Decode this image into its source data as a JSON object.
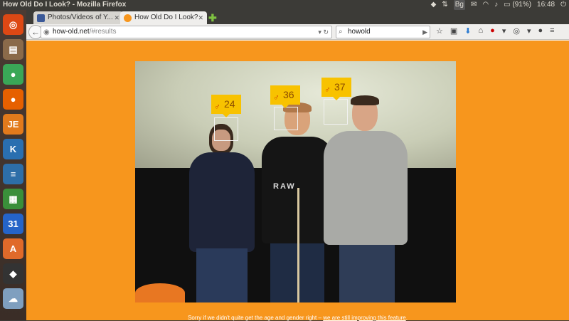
{
  "system": {
    "window_title": "How Old Do I Look? - Mozilla Firefox",
    "battery": "(91%)",
    "clock": "16:48",
    "keyboard": "Bg"
  },
  "launcher": {
    "items": [
      {
        "name": "ubuntu-logo-icon",
        "glyph": "◎",
        "color": "#dd4814"
      },
      {
        "name": "files-icon",
        "glyph": "▤",
        "color": "#8a6a4a"
      },
      {
        "name": "chromium-icon",
        "glyph": "●",
        "color": "#3aa757"
      },
      {
        "name": "firefox-icon",
        "glyph": "●",
        "color": "#e66000"
      },
      {
        "name": "jetbrains-icon",
        "glyph": "JE",
        "color": "#e27a1c"
      },
      {
        "name": "kde-connect-icon",
        "glyph": "K",
        "color": "#2a6fb0"
      },
      {
        "name": "writer-icon",
        "glyph": "≡",
        "color": "#2d6ea8"
      },
      {
        "name": "calc-icon",
        "glyph": "▦",
        "color": "#3a8f3a"
      },
      {
        "name": "calendar-icon",
        "glyph": "31",
        "color": "#2564c8"
      },
      {
        "name": "software-center-icon",
        "glyph": "A",
        "color": "#e06a2a"
      },
      {
        "name": "inkscape-icon",
        "glyph": "◆",
        "color": "#333333"
      },
      {
        "name": "weather-icon",
        "glyph": "☁",
        "color": "#7f9fbf"
      }
    ]
  },
  "tabs": [
    {
      "label": "Photos/Videos of Y...",
      "active": false,
      "icon": "facebook-icon"
    },
    {
      "label": "How Old Do I Look?",
      "active": true,
      "icon": "how-old-icon"
    }
  ],
  "nav": {
    "url_host": "how-old.net",
    "url_path": "/#results",
    "search_value": "howold"
  },
  "page": {
    "caption_text": "Sorry if we didn't quite get the age and gender right –",
    "caption_link": "we are still improving this feature",
    "caption_end": ".",
    "faces": [
      {
        "age": "24",
        "gender": "male"
      },
      {
        "age": "36",
        "gender": "male"
      },
      {
        "age": "37",
        "gender": "male"
      }
    ]
  }
}
